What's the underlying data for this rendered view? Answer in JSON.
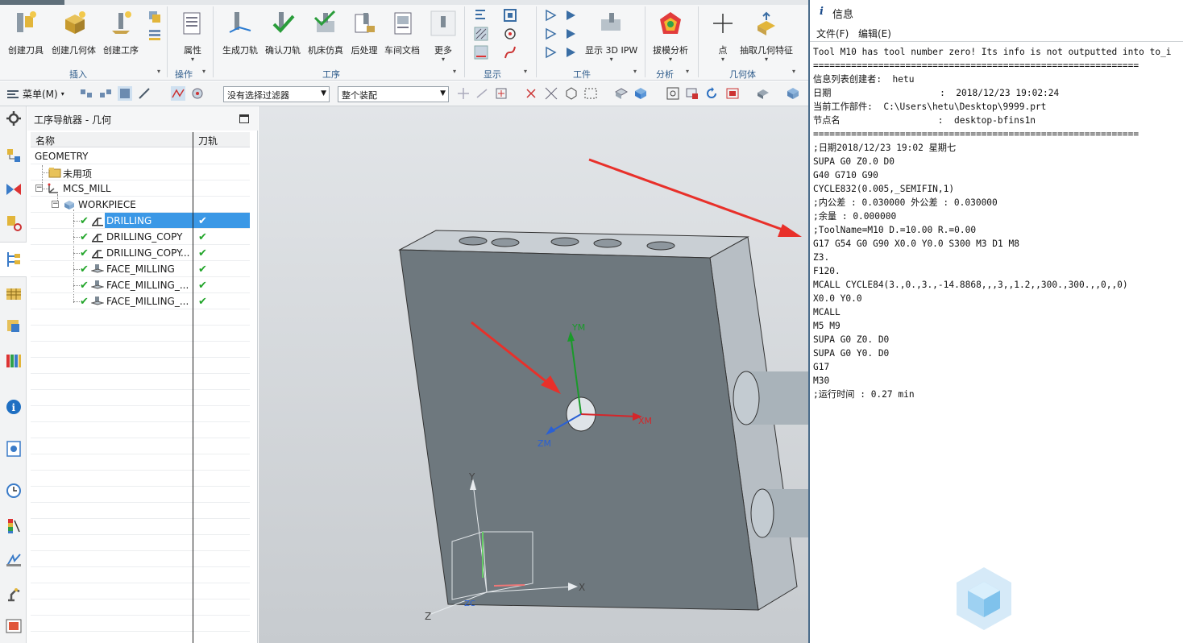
{
  "ribbon": {
    "buttons": [
      {
        "label": "创建刀具",
        "icon": "create-tool-icon"
      },
      {
        "label": "创建几何体",
        "icon": "create-geometry-icon"
      },
      {
        "label": "创建工序",
        "icon": "create-operation-icon"
      },
      {
        "label": "属性",
        "icon": "properties-icon"
      },
      {
        "label": "生成刀轨",
        "icon": "generate-toolpath-icon"
      },
      {
        "label": "确认刀轨",
        "icon": "verify-toolpath-icon"
      },
      {
        "label": "机床仿真",
        "icon": "machine-simulation-icon"
      },
      {
        "label": "后处理",
        "icon": "postprocess-icon"
      },
      {
        "label": "车间文档",
        "icon": "shop-docs-icon"
      },
      {
        "label": "更多",
        "icon": "more-icon"
      },
      {
        "label": "显示 3D IPW",
        "icon": "show-3d-ipw-icon"
      },
      {
        "label": "拔模分析",
        "icon": "draft-analysis-icon"
      },
      {
        "label": "点",
        "icon": "point-icon"
      },
      {
        "label": "抽取几何特征",
        "icon": "extract-geometry-icon"
      }
    ],
    "groups": {
      "insert": "插入",
      "operation": "操作",
      "process": "工序",
      "display": "显示",
      "workpiece": "工件",
      "analysis": "分析",
      "geometry": "几何体"
    }
  },
  "toolbar2": {
    "menu_label": "菜单(M)",
    "filter_value": "没有选择过滤器",
    "assembly_value": "整个装配"
  },
  "navigator": {
    "title": "工序导航器 - 几何",
    "col_name": "名称",
    "col_toolpath": "刀轨",
    "rows": [
      {
        "label": "GEOMETRY"
      },
      {
        "label": "未用项"
      },
      {
        "label": "MCS_MILL"
      },
      {
        "label": "WORKPIECE"
      },
      {
        "label": "DRILLING",
        "check": "✔"
      },
      {
        "label": "DRILLING_COPY",
        "check": "✔"
      },
      {
        "label": "DRILLING_COPY...",
        "check": "✔"
      },
      {
        "label": "FACE_MILLING",
        "check": "✔"
      },
      {
        "label": "FACE_MILLING_...",
        "check": "✔"
      },
      {
        "label": "FACE_MILLING_...",
        "check": "✔"
      }
    ]
  },
  "viewport": {
    "wcs_labels": {
      "ym": "YM",
      "xm": "XM",
      "zm": "ZM"
    },
    "abs_labels": {
      "x": "X",
      "y": "Y",
      "z": "Z",
      "zc": "ZC"
    }
  },
  "info": {
    "title": "信息",
    "menu_file": "文件(F)",
    "menu_edit": "编辑(E)",
    "lines": [
      "Tool M10 has tool number zero! Its info is not outputted into to_i",
      "============================================================",
      "信息列表创建者:  hetu",
      "日期                    :  2018/12/23 19:02:24",
      "当前工作部件:  C:\\Users\\hetu\\Desktop\\9999.prt",
      "节点名                  :  desktop-bfins1n",
      "============================================================",
      ";日期2018/12/23 19:02 星期七",
      "SUPA G0 Z0.0 D0",
      "G40 G710 G90",
      "CYCLE832(0.005,_SEMIFIN,1)",
      ";内公差 : 0.030000 外公差 : 0.030000",
      ";余量 : 0.000000",
      ";ToolName=M10 D.=10.00 R.=0.00",
      "G17 G54 G0 G90 X0.0 Y0.0 S300 M3 D1 M8",
      "Z3.",
      "F120.",
      "MCALL CYCLE84(3.,0.,3.,-14.8868,,,3,,1.2,,300.,300.,,0,,0)",
      "X0.0 Y0.0",
      "MCALL",
      "M5 M9",
      "SUPA G0 Z0. D0",
      "SUPA G0 Y0. D0",
      "G17",
      "M30",
      ";运行时间 : 0.27 min"
    ]
  }
}
